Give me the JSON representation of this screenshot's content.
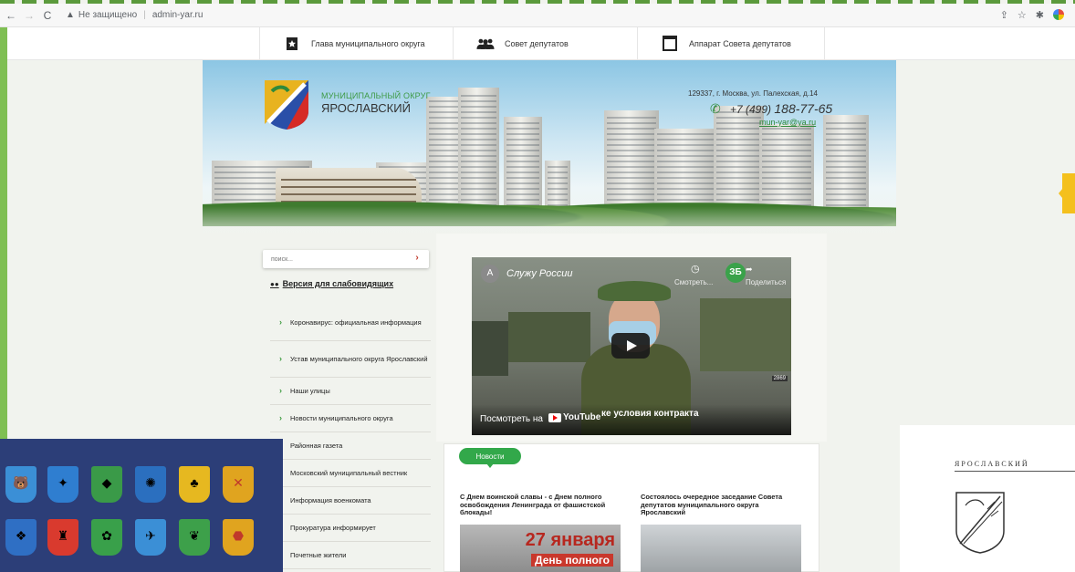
{
  "browser": {
    "back_icon": "arrow-left-icon",
    "forward_icon": "arrow-right-icon",
    "reload_icon": "reload-icon",
    "security_label": "Не защищено",
    "url": "admin-yar.ru"
  },
  "topnav": {
    "items": [
      {
        "label": "Глава муниципального округа",
        "icon": "star-badge-icon"
      },
      {
        "label": "Совет депутатов",
        "icon": "people-icon"
      },
      {
        "label": "Аппарат Совета депутатов",
        "icon": "monitor-icon"
      }
    ]
  },
  "header": {
    "brand_line1": "МУНИЦИПАЛЬНЫЙ ОКРУГ",
    "brand_line2": "ЯРОСЛАВСКИЙ",
    "address": "129337, г. Москва, ул. Палехская, д.14",
    "phone_prefix": "+7 (499)",
    "phone_number": "188-77-65",
    "email": "mun-yar@ya.ru"
  },
  "search": {
    "placeholder": "поиск..."
  },
  "sidebar": {
    "accessibility_link": "Версия для слабовидящих",
    "items": [
      {
        "label": "Коронавирус: официальная информация"
      },
      {
        "label": "Устав муниципального округа Ярославский"
      },
      {
        "label": "Наши улицы"
      },
      {
        "label": "Новости муниципального округа"
      },
      {
        "label": "Районная газета"
      },
      {
        "label": "Московский муниципальный вестник"
      },
      {
        "label": "Информация военкомата"
      },
      {
        "label": "Прокуратура информирует"
      },
      {
        "label": "Почетные жители"
      }
    ]
  },
  "video": {
    "channel_letter": "А",
    "title": "Служу России",
    "watch_later": "Смотреть...",
    "channel_badge": "ЗБ",
    "share": "Поделиться",
    "caption": "ке условия контракта",
    "watch_on": "Посмотреть на",
    "youtube": "YouTube",
    "frame_number": "2869"
  },
  "news": {
    "tab_label": "Новости",
    "items": [
      {
        "headline": "С Днем воинской славы - с Днем полного освобождения Ленинграда от фашистской блокады!",
        "thumb_line1": "27 января",
        "thumb_line2": "День полного"
      },
      {
        "headline": "Состоялось очередное заседание Совета депутатов муниципального округа Ярославский"
      }
    ]
  },
  "right_card": {
    "title": "ЯРОСЛАВСКИЙ"
  },
  "colors": {
    "accent_green": "#32a84a",
    "frame_green": "#7fbf53",
    "arms_background": "#2c3e78",
    "side_tab_yellow": "#f4c01d"
  }
}
